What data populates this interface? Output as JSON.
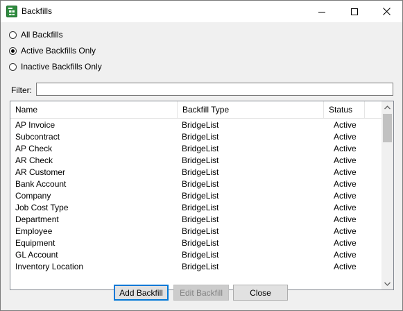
{
  "window": {
    "title": "Backfills",
    "icon": "spreadsheet-app-icon",
    "controls": {
      "minimize": "minimize-icon",
      "maximize": "maximize-icon",
      "close": "close-icon"
    }
  },
  "filters": {
    "radio_all": "All Backfills",
    "radio_active": "Active Backfills Only",
    "radio_inactive": "Inactive Backfills Only",
    "selected": "Active Backfills Only"
  },
  "filter": {
    "label": "Filter:",
    "value": "",
    "placeholder": ""
  },
  "table": {
    "columns": [
      "Name",
      "Backfill Type",
      "Status"
    ],
    "rows": [
      [
        "AP Invoice",
        "BridgeList",
        "Active"
      ],
      [
        "Subcontract",
        "BridgeList",
        "Active"
      ],
      [
        "AP Check",
        "BridgeList",
        "Active"
      ],
      [
        "AR Check",
        "BridgeList",
        "Active"
      ],
      [
        "AR Customer",
        "BridgeList",
        "Active"
      ],
      [
        "Bank Account",
        "BridgeList",
        "Active"
      ],
      [
        "Company",
        "BridgeList",
        "Active"
      ],
      [
        "Job Cost Type",
        "BridgeList",
        "Active"
      ],
      [
        "Department",
        "BridgeList",
        "Active"
      ],
      [
        "Employee",
        "BridgeList",
        "Active"
      ],
      [
        "Equipment",
        "BridgeList",
        "Active"
      ],
      [
        "GL Account",
        "BridgeList",
        "Active"
      ],
      [
        "Inventory Location",
        "BridgeList",
        "Active"
      ]
    ]
  },
  "buttons": {
    "add": "Add Backfill",
    "edit": "Edit Backfill",
    "close": "Close"
  },
  "colors": {
    "focus_border": "#0078d7",
    "app_icon_green": "#2e8b3e"
  }
}
